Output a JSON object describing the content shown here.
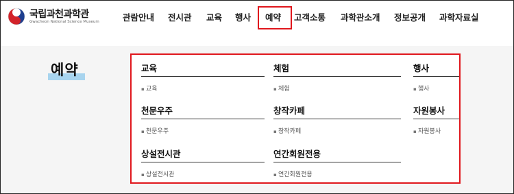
{
  "brand": {
    "name_ko": "국립과천과학관",
    "name_en": "Gwacheon National Science Museum"
  },
  "nav": [
    {
      "label": "관람안내"
    },
    {
      "label": "전시관"
    },
    {
      "label": "교육"
    },
    {
      "label": "행사"
    },
    {
      "label": "예약",
      "active": true
    },
    {
      "label": "고객소통"
    },
    {
      "label": "과학관소개"
    },
    {
      "label": "정보공개"
    },
    {
      "label": "과학자료실"
    }
  ],
  "page": {
    "title": "예약"
  },
  "menu": {
    "groups": [
      {
        "title": "교육",
        "items": [
          "교육"
        ]
      },
      {
        "title": "체험",
        "items": [
          "체험"
        ]
      },
      {
        "title": "행사",
        "items": [
          "행사"
        ]
      },
      {
        "title": "천문우주",
        "items": [
          "천문우주"
        ]
      },
      {
        "title": "창작카페",
        "items": [
          "창작카페"
        ]
      },
      {
        "title": "자원봉사",
        "items": [
          "자원봉사"
        ]
      },
      {
        "title": "상설전시관",
        "items": [
          "상설전시관"
        ]
      },
      {
        "title": "연간회원전용",
        "items": [
          "연간회원전용"
        ]
      }
    ]
  },
  "colors": {
    "highlight": "#e0161c",
    "title_underline": "#a8d4ee",
    "band": "#f5f5f5"
  }
}
